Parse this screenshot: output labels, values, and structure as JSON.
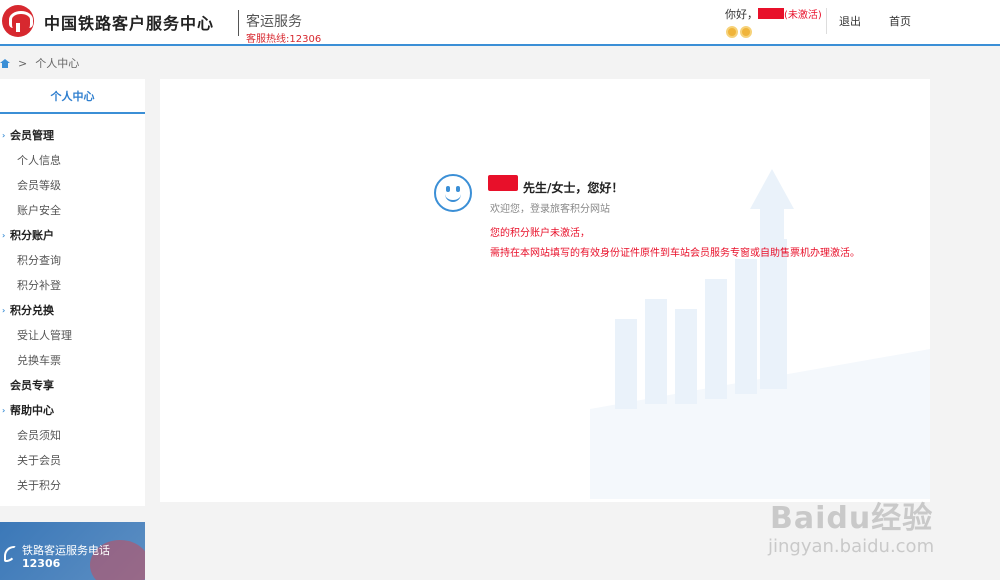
{
  "header": {
    "site_name": "中国铁路客户服务中心",
    "service_title": "客运服务",
    "hotline": "客服热线:12306",
    "greeting_prefix": "你好，",
    "account_status": "(未激活)",
    "logout": "退出",
    "home": "首页"
  },
  "breadcrumb": {
    "separator": ">",
    "current": "个人中心"
  },
  "sidebar": {
    "title": "个人中心",
    "groups": [
      {
        "label": "会员管理",
        "items": [
          "个人信息",
          "会员等级",
          "账户安全"
        ]
      },
      {
        "label": "积分账户",
        "items": [
          "积分查询",
          "积分补登"
        ]
      },
      {
        "label": "积分兑换",
        "items": [
          "受让人管理",
          "兑换车票"
        ]
      },
      {
        "label": "会员专享",
        "items": []
      },
      {
        "label": "帮助中心",
        "items": [
          "会员须知",
          "关于会员",
          "关于积分"
        ]
      }
    ]
  },
  "promo": {
    "title": "铁路客运服务电话",
    "phone": "12306"
  },
  "main": {
    "welcome_title": "先生/女士，您好！",
    "welcome_sub": "欢迎您，登录旅客积分网站",
    "notice_line1": "您的积分账户未激活，",
    "notice_line2": "需持在本网站填写的有效身份证件原件到车站会员服务专窗或自助售票机办理激活。"
  },
  "watermark": {
    "brand": "Baidu经验",
    "url": "jingyan.baidu.com"
  },
  "colors": {
    "accent": "#3b8fd6",
    "alert": "#e8102a",
    "logo_red": "#d7282f"
  }
}
